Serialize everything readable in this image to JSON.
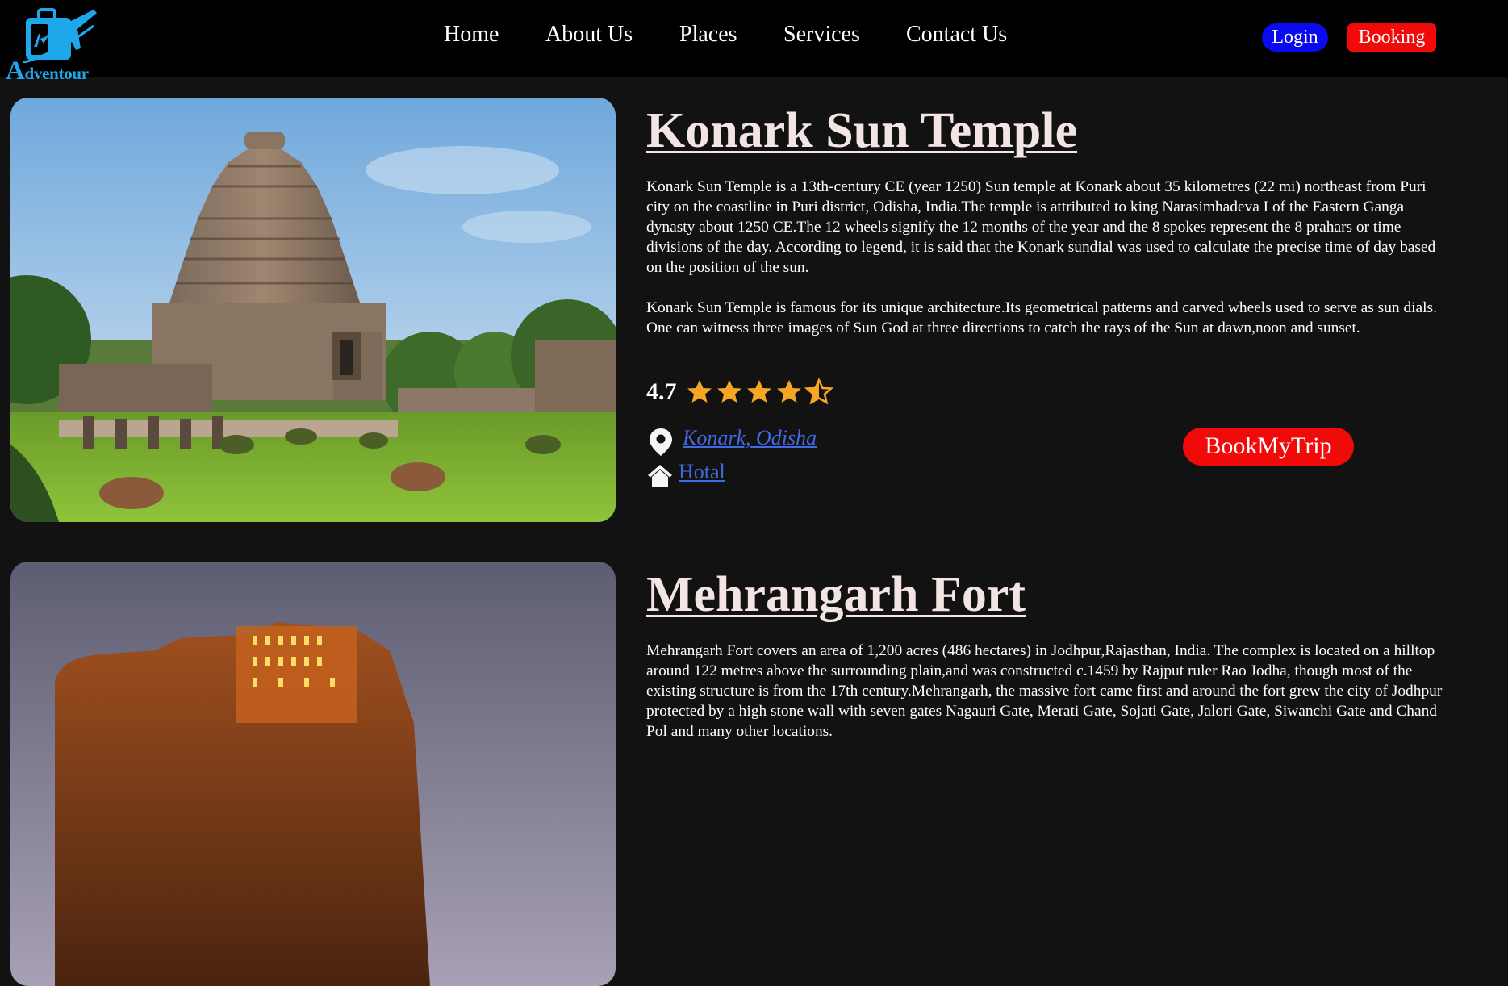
{
  "header": {
    "logo_text_first": "A",
    "logo_text_rest": "dventour",
    "nav": [
      {
        "label": "Home"
      },
      {
        "label": "About Us"
      },
      {
        "label": "Places"
      },
      {
        "label": "Services"
      },
      {
        "label": "Contact Us"
      }
    ],
    "login_label": "Login",
    "booking_label": "Booking"
  },
  "places": [
    {
      "title": "Konark Sun Temple",
      "paragraph1": "Konark Sun Temple is a 13th-century CE (year 1250) Sun temple at Konark about 35 kilometres (22 mi) northeast from Puri city on the coastline in Puri district, Odisha, India.The temple is attributed to king Narasimhadeva I of the Eastern Ganga dynasty about 1250 CE.The 12 wheels signify the 12 months of the year and the 8 spokes represent the 8 prahars or time divisions of the day. According to legend, it is said that the Konark sundial was used to calculate the precise time of day based on the position of the sun.",
      "paragraph2": "Konark Sun Temple is famous for its unique architecture.Its geometrical patterns and carved wheels used to serve as sun dials. One can witness three images of Sun God at three directions to catch the rays of the Sun at dawn,noon and sunset.",
      "rating": "4.7",
      "stars_value": 4.5,
      "location": "Konark, Odisha",
      "hotel": "Hotal",
      "book_label": "BookMyTrip"
    },
    {
      "title": "Mehrangarh Fort",
      "paragraph1": "Mehrangarh Fort covers an area of 1,200 acres (486 hectares) in Jodhpur,Rajasthan, India. The complex is located on a hilltop around 122 metres above the surrounding plain,and was constructed c.1459 by Rajput ruler Rao Jodha, though most of the existing structure is from the 17th century.Mehrangarh, the massive fort came first and around the fort grew the city of Jodhpur protected by a high stone wall with seven gates Nagauri Gate, Merati Gate, Sojati Gate, Jalori Gate, Siwanchi Gate and Chand Pol and many other locations."
    }
  ],
  "colors": {
    "page_bg": "#121212",
    "header_bg": "#000000",
    "title": "#f3e5e3",
    "link": "#4169e1",
    "login_bg": "#0a0af0",
    "booking_bg": "#f00a0a",
    "star": "#f5a623",
    "logo": "#1ea7ea"
  },
  "icons": {
    "logo": "suitcase-airplane-icon",
    "location": "map-pin-icon",
    "hotel": "house-icon",
    "star": "star-icon"
  }
}
